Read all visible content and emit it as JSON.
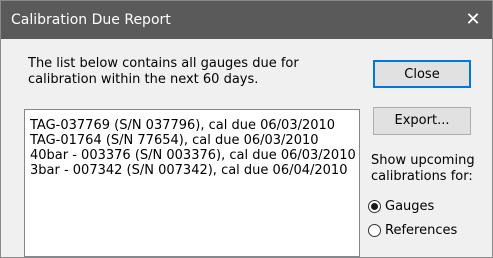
{
  "window": {
    "title": "Calibration Due Report",
    "close_glyph": "✕"
  },
  "description": "The list below contains all gauges due for calibration within the next 60 days.",
  "buttons": {
    "close": "Close",
    "export": "Export..."
  },
  "list": {
    "items": [
      "TAG-037769 (S/N 037796), cal due 06/03/2010",
      "TAG-01764 (S/N 77654), cal due 06/03/2010",
      "40bar - 003376 (S/N 003376), cal due 06/03/2010",
      "3bar - 007342 (S/N 007342), cal due 06/04/2010"
    ]
  },
  "show_upcoming": {
    "label": "Show upcoming calibrations for:",
    "options": [
      {
        "label": "Gauges",
        "selected": true
      },
      {
        "label": "References",
        "selected": false
      }
    ]
  },
  "colors": {
    "titlebar": "#5a5a5a",
    "default_button_border": "#0078d7"
  }
}
